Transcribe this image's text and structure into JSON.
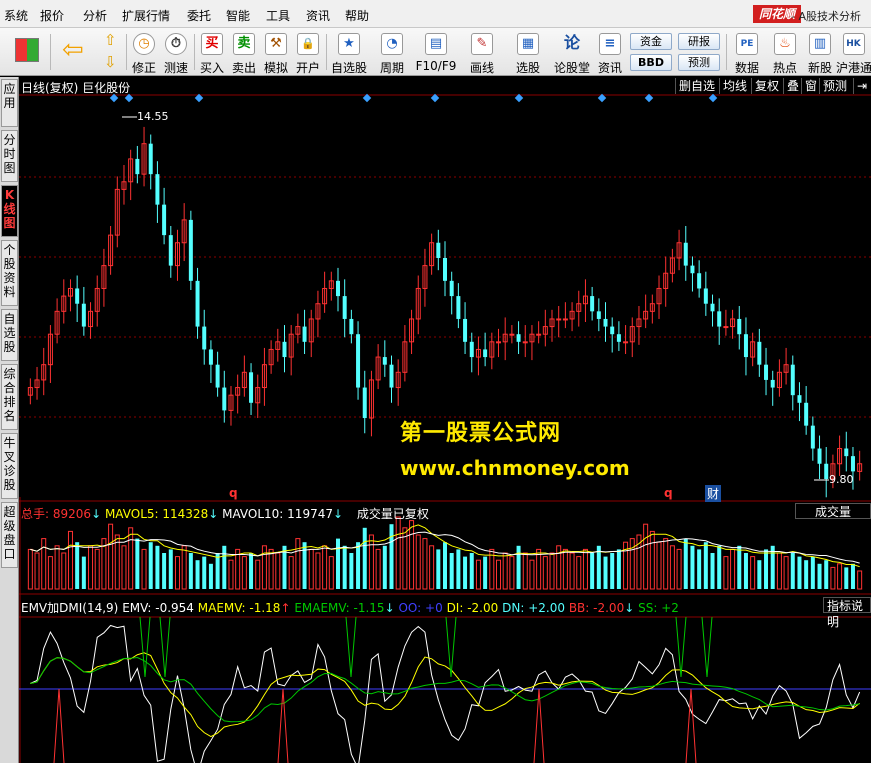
{
  "menubar": {
    "items": [
      "系统",
      "报价",
      "分析",
      "扩展行情",
      "委托",
      "智能",
      "工具",
      "资讯",
      "帮助"
    ],
    "brand": "同花顺",
    "brand_subtitle": "- A股技术分析"
  },
  "toolbar": {
    "buttons": [
      {
        "label": "修正",
        "icon": "clock-icon",
        "glyph": "◷"
      },
      {
        "label": "测速",
        "icon": "timer-icon",
        "glyph": "⏱"
      },
      {
        "label": "买入",
        "icon": "buy-icon",
        "glyph": "买"
      },
      {
        "label": "卖出",
        "icon": "sell-icon",
        "glyph": "卖"
      },
      {
        "label": "模拟",
        "icon": "hammer-icon",
        "glyph": "⚒"
      },
      {
        "label": "开户",
        "icon": "lock-icon",
        "glyph": "🔒"
      },
      {
        "label": "自选股",
        "icon": "star-icon",
        "glyph": "★"
      },
      {
        "label": "周期",
        "icon": "cycle-icon",
        "glyph": "◔"
      },
      {
        "label": "F10/F9",
        "icon": "f10-icon",
        "glyph": "▤"
      },
      {
        "label": "画线",
        "icon": "pencil-icon",
        "glyph": "✎"
      },
      {
        "label": "选股",
        "icon": "filter-icon",
        "glyph": "▦"
      },
      {
        "label": "论股堂",
        "icon": "forum-icon",
        "glyph": "论"
      },
      {
        "label": "资讯",
        "icon": "news-icon",
        "glyph": "≡"
      },
      {
        "label": "数据",
        "icon": "pe-data-icon",
        "glyph": "PE"
      },
      {
        "label": "热点",
        "icon": "hot-icon",
        "glyph": "♨"
      },
      {
        "label": "新股",
        "icon": "new-stock-icon",
        "glyph": "▥"
      },
      {
        "label": "沪港通",
        "icon": "sse-hk-icon",
        "glyph": "HK"
      }
    ],
    "mini_buttons": [
      "资金",
      "研报",
      "BBD",
      "预测"
    ]
  },
  "sidebar": {
    "tabs": [
      "应用",
      "分时图",
      "K线图",
      "个股资料",
      "自选股",
      "综合排名",
      "牛叉诊股",
      "超级盘口"
    ]
  },
  "chart_header": {
    "title": "日线(复权) 巨化股份",
    "right_buttons": [
      "删自选",
      "均线",
      "复权",
      "叠",
      "窗",
      "预测"
    ]
  },
  "price_panel": {
    "high_label": "14.55",
    "low_label": "9.80",
    "marker_q": "q",
    "marker_cai": "财"
  },
  "watermark": {
    "line1": "第一股票公式网",
    "line2": "www.chnmoney.com"
  },
  "volume_panel": {
    "zongshou_label": "总手:",
    "zongshou_value": "89206",
    "mavol5_label": "MAVOL5:",
    "mavol5_value": "114328",
    "mavol10_label": "MAVOL10:",
    "mavol10_value": "119747",
    "note": "成交量已复权",
    "right_label": "成交量"
  },
  "indicator_panel": {
    "name": "EMV加DMI(14,9)",
    "emv_label": "EMV:",
    "emv_value": "-0.954",
    "maemv_label": "MAEMV:",
    "maemv_value": "-1.18",
    "emaemv_label": "EMAEMV:",
    "emaemv_value": "-1.15",
    "oo_label": "OO:",
    "oo_value": "+0",
    "di_label": "DI:",
    "di_value": "-2.00",
    "dn_label": "DN:",
    "dn_value": "+2.00",
    "bb_label": "BB:",
    "bb_value": "-2.00",
    "ss_label": "SS:",
    "ss_value": "+2",
    "right_label": "指标说明"
  },
  "colors": {
    "up": "#ff3232",
    "down": "#54ffff",
    "yellow": "#ffff00",
    "green": "#00c800",
    "blue": "#4040ff",
    "white": "#ffffff",
    "grid": "#8b0000"
  },
  "chart_data": {
    "type": "candlestick",
    "price_labels": {
      "max": 14.55,
      "min": 9.8
    },
    "closes": [
      11.0,
      11.1,
      11.3,
      11.7,
      12.0,
      12.2,
      12.3,
      12.1,
      11.8,
      12.0,
      12.3,
      12.6,
      13.0,
      13.6,
      13.7,
      14.0,
      13.8,
      14.2,
      13.8,
      13.4,
      13.0,
      12.6,
      12.9,
      13.2,
      12.4,
      11.8,
      11.5,
      11.3,
      11.0,
      10.7,
      10.9,
      11.0,
      11.2,
      10.8,
      11.0,
      11.3,
      11.5,
      11.6,
      11.4,
      11.7,
      11.8,
      11.6,
      11.9,
      12.1,
      12.3,
      12.4,
      12.2,
      11.9,
      11.7,
      11.0,
      10.6,
      11.1,
      11.4,
      11.3,
      11.0,
      11.2,
      11.6,
      11.9,
      12.3,
      12.6,
      12.9,
      12.7,
      12.4,
      12.2,
      11.9,
      11.6,
      11.4,
      11.5,
      11.4,
      11.6,
      11.6,
      11.7,
      11.7,
      11.6,
      11.6,
      11.7,
      11.7,
      11.8,
      11.9,
      11.9,
      11.9,
      12.0,
      12.1,
      12.2,
      12.0,
      11.9,
      11.8,
      11.7,
      11.6,
      11.6,
      11.8,
      11.9,
      12.0,
      12.1,
      12.3,
      12.5,
      12.7,
      12.9,
      12.6,
      12.5,
      12.3,
      12.1,
      12.0,
      11.8,
      11.8,
      11.9,
      11.7,
      11.4,
      11.6,
      11.3,
      11.1,
      11.0,
      11.2,
      11.3,
      10.9,
      10.8,
      10.5,
      10.2,
      10.0,
      9.8,
      10.0,
      10.2,
      10.1,
      9.9,
      10.0
    ],
    "volume": [
      0.55,
      0.5,
      0.7,
      0.45,
      0.6,
      0.5,
      0.8,
      0.65,
      0.45,
      0.6,
      0.55,
      0.7,
      0.9,
      0.75,
      0.6,
      0.85,
      0.7,
      0.55,
      0.65,
      0.6,
      0.5,
      0.55,
      0.45,
      0.6,
      0.5,
      0.4,
      0.45,
      0.35,
      0.5,
      0.6,
      0.4,
      0.55,
      0.45,
      0.5,
      0.4,
      0.6,
      0.55,
      0.5,
      0.6,
      0.45,
      0.7,
      0.65,
      0.55,
      0.5,
      0.6,
      0.45,
      0.7,
      0.6,
      0.5,
      0.65,
      0.85,
      0.75,
      0.55,
      0.6,
      0.9,
      1.0,
      0.85,
      0.95,
      0.75,
      0.7,
      0.6,
      0.55,
      0.65,
      0.5,
      0.55,
      0.45,
      0.5,
      0.4,
      0.45,
      0.55,
      0.4,
      0.5,
      0.45,
      0.6,
      0.5,
      0.4,
      0.55,
      0.45,
      0.5,
      0.6,
      0.55,
      0.5,
      0.45,
      0.55,
      0.5,
      0.6,
      0.45,
      0.5,
      0.55,
      0.65,
      0.7,
      0.75,
      0.9,
      0.8,
      0.65,
      0.7,
      0.6,
      0.55,
      0.7,
      0.6,
      0.55,
      0.65,
      0.5,
      0.6,
      0.45,
      0.55,
      0.6,
      0.5,
      0.45,
      0.4,
      0.55,
      0.6,
      0.5,
      0.45,
      0.5,
      0.45,
      0.4,
      0.45,
      0.35,
      0.4,
      0.3,
      0.35,
      0.3,
      0.35,
      0.25
    ]
  }
}
